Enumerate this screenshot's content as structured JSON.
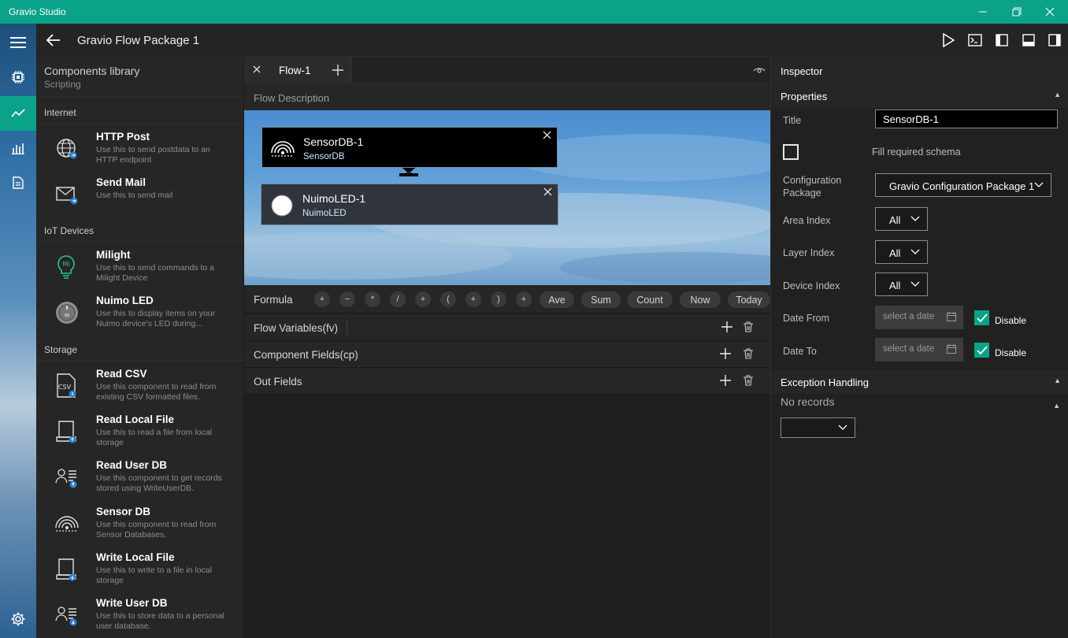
{
  "window": {
    "title": "Gravio Studio"
  },
  "header": {
    "title": "Gravio Flow Package 1"
  },
  "library": {
    "heading": "Components library",
    "scripting_label": "Scripting",
    "sections": [
      {
        "label": "Internet",
        "items": [
          {
            "name": "HTTP Post",
            "desc": "Use this to send postdata to an HTTP endpoint",
            "icon": "globe-icon"
          },
          {
            "name": "Send Mail",
            "desc": "Use this to send mail",
            "icon": "mail-icon"
          }
        ]
      },
      {
        "label": "IoT Devices",
        "items": [
          {
            "name": "Milight",
            "desc": "Use this to send commands to a Milight Device",
            "icon": "milight-bulb-icon"
          },
          {
            "name": "Nuimo LED",
            "desc": "Use this to display items on your Nuimo device's LED during...",
            "icon": "nuimo-icon"
          }
        ]
      },
      {
        "label": "Storage",
        "items": [
          {
            "name": "Read CSV",
            "desc": "Use this component to read from existing CSV formatted files.",
            "icon": "csv-file-icon"
          },
          {
            "name": "Read Local File",
            "desc": "Use this to read a file from local storage",
            "icon": "drive-read-icon"
          },
          {
            "name": "Read User DB",
            "desc": "Use this component to get records stored using WriteUserDB.",
            "icon": "user-db-read-icon"
          },
          {
            "name": "Sensor DB",
            "desc": "Use this component to read from Sensor Databases.",
            "icon": "sensor-db-icon"
          },
          {
            "name": "Write Local File",
            "desc": "Use this to write to a file in local storage",
            "icon": "drive-write-icon"
          },
          {
            "name": "Write User DB",
            "desc": "Use this to store data to a personal user database.",
            "icon": "user-db-write-icon"
          }
        ]
      }
    ]
  },
  "tabs": {
    "active": "Flow-1"
  },
  "flow": {
    "description_label": "Flow Description",
    "nodes": [
      {
        "name": "SensorDB-1",
        "type": "SensorDB"
      },
      {
        "name": "NuimoLED-1",
        "type": "NuimoLED"
      }
    ]
  },
  "formula": {
    "label": "Formula",
    "ops": [
      "+",
      "−",
      "*",
      "/",
      "+",
      "(",
      "+",
      ")",
      "+"
    ],
    "functions": [
      "Ave",
      "Sum",
      "Count",
      "Now",
      "Today"
    ]
  },
  "rows": {
    "flow_variables": "Flow Variables(fv)",
    "component_fields": "Component Fields(cp)",
    "out_fields": "Out Fields"
  },
  "inspector": {
    "heading": "Inspector",
    "properties_label": "Properties",
    "title_label": "Title",
    "title_value": "SensorDB-1",
    "fill_schema_label": "Fill required schema",
    "config_label": "Configuration Package",
    "config_value": "Gravio Configuration Package 1",
    "area_label": "Area Index",
    "area_value": "All",
    "layer_label": "Layer Index",
    "layer_value": "All",
    "device_label": "Device Index",
    "device_value": "All",
    "date_from_label": "Date From",
    "date_to_label": "Date To",
    "date_placeholder": "select a date",
    "disable_label": "Disable",
    "exception_label": "Exception Handling",
    "no_records": "No records"
  },
  "colors": {
    "accent": "#0aa38a",
    "background": "#1f1f1f",
    "panel": "#262626"
  }
}
